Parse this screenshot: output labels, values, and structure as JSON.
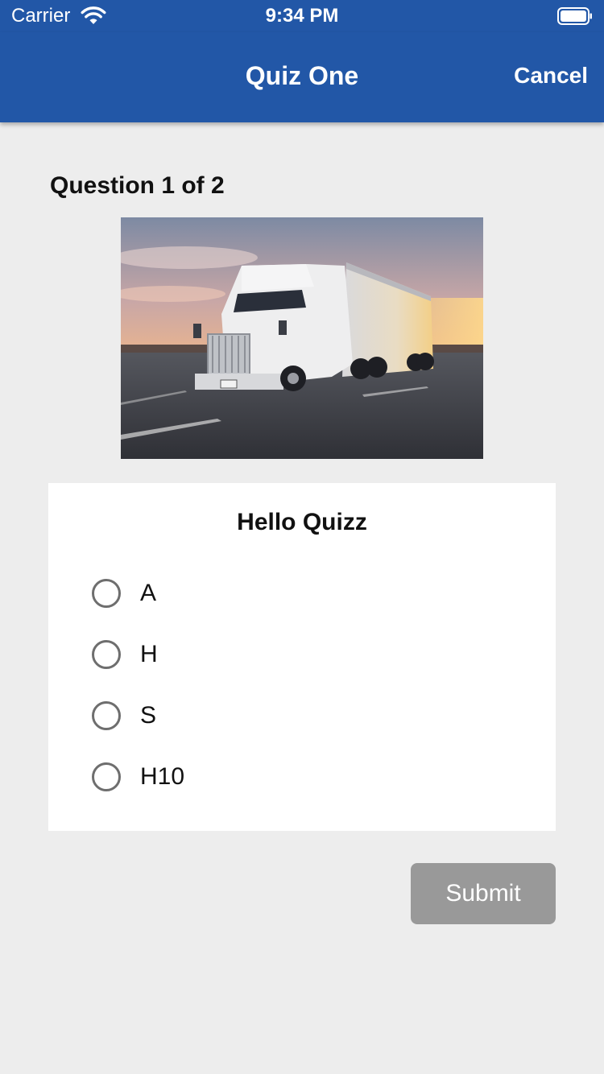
{
  "status_bar": {
    "carrier": "Carrier",
    "time": "9:34 PM",
    "wifi_icon": "wifi-icon",
    "battery_icon": "battery-icon"
  },
  "nav": {
    "title": "Quiz One",
    "cancel_label": "Cancel",
    "background_color": "#2257a7"
  },
  "quiz": {
    "counter": "Question 1 of 2",
    "image": "semi-truck-on-highway-at-sunset",
    "question_text": "Hello Quizz",
    "options": [
      {
        "label": "A",
        "selected": false
      },
      {
        "label": "H",
        "selected": false
      },
      {
        "label": "S",
        "selected": false
      },
      {
        "label": "H10",
        "selected": false
      }
    ],
    "submit_label": "Submit",
    "submit_enabled": false
  }
}
